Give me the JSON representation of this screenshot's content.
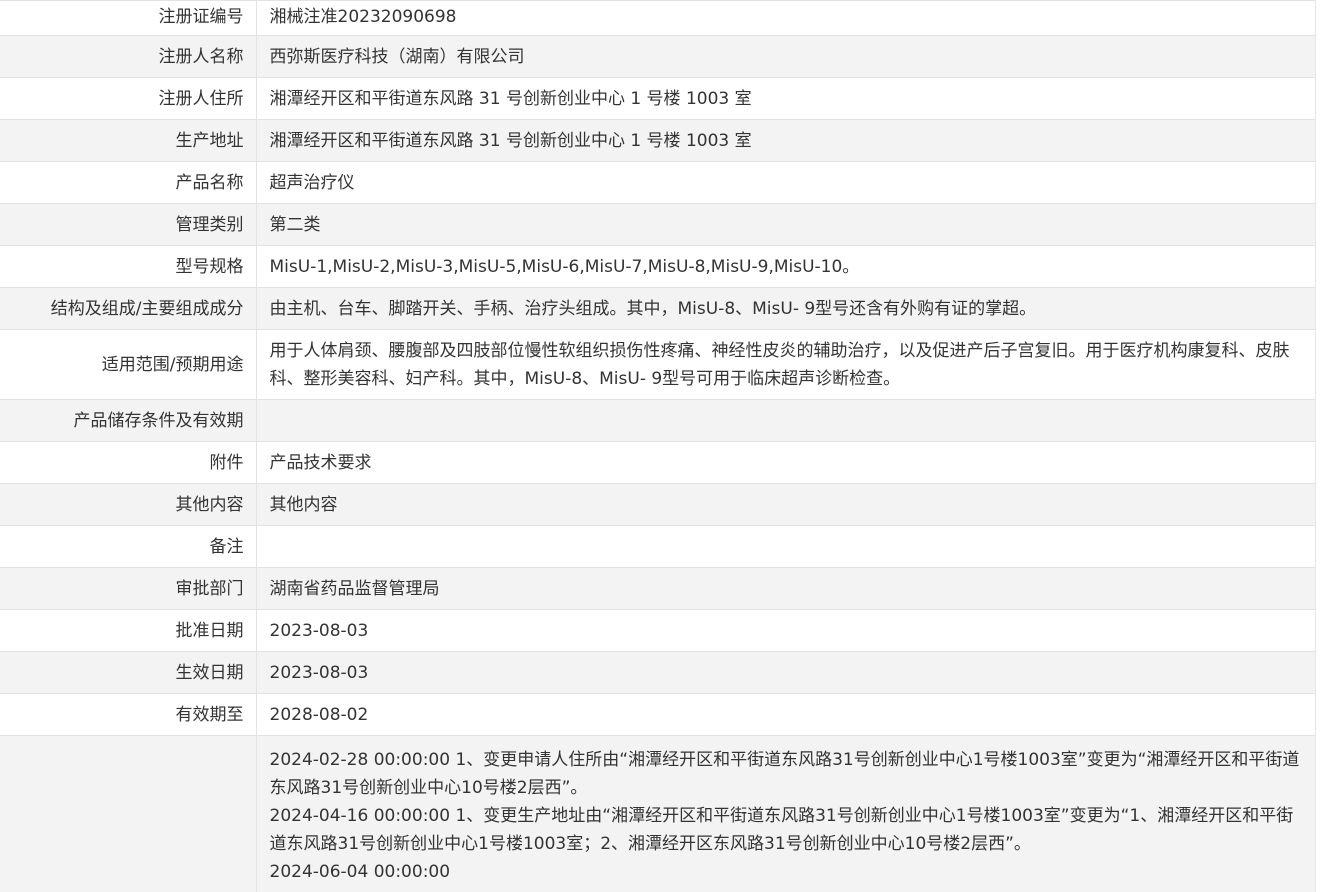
{
  "rows": [
    {
      "label": "注册证编号",
      "value": "湘械注准20232090698"
    },
    {
      "label": "注册人名称",
      "value": "西弥斯医疗科技（湖南）有限公司"
    },
    {
      "label": "注册人住所",
      "value": "湘潭经开区和平街道东风路 31 号创新创业中心 1 号楼 1003 室"
    },
    {
      "label": "生产地址",
      "value": "湘潭经开区和平街道东风路 31 号创新创业中心 1 号楼 1003 室"
    },
    {
      "label": "产品名称",
      "value": "超声治疗仪"
    },
    {
      "label": "管理类别",
      "value": "第二类"
    },
    {
      "label": "型号规格",
      "value": "MisU-1,MisU-2,MisU-3,MisU-5,MisU-6,MisU-7,MisU-8,MisU-9,MisU-10。"
    },
    {
      "label": "结构及组成/主要组成成分",
      "value": "由主机、台车、脚踏开关、手柄、治疗头组成。其中，MisU-8、MisU- 9型号还含有外购有证的掌超。"
    },
    {
      "label": "适用范围/预期用途",
      "value": "用于人体肩颈、腰腹部及四肢部位慢性软组织损伤性疼痛、神经性皮炎的辅助治疗，以及促进产后子宫复旧。用于医疗机构康复科、皮肤科、整形美容科、妇产科。其中，MisU-8、MisU- 9型号可用于临床超声诊断检查。"
    },
    {
      "label": "产品储存条件及有效期",
      "value": ""
    },
    {
      "label": "附件",
      "value": "产品技术要求"
    },
    {
      "label": "其他内容",
      "value": "其他内容"
    },
    {
      "label": "备注",
      "value": ""
    },
    {
      "label": "审批部门",
      "value": "湖南省药品监督管理局"
    },
    {
      "label": "批准日期",
      "value": "2023-08-03"
    },
    {
      "label": "生效日期",
      "value": "2023-08-03"
    },
    {
      "label": "有效期至",
      "value": "2028-08-02"
    }
  ],
  "change_history": {
    "label": "",
    "entries": [
      "2024-02-28 00:00:00 1、变更申请人住所由“湘潭经开区和平街道东风路31号创新创业中心1号楼1003室”变更为“湘潭经开区和平街道东风路31号创新创业中心10号楼2层西”。",
      "2024-04-16 00:00:00 1、变更生产地址由“湘潭经开区和平街道东风路31号创新创业中心1号楼1003室”变更为“1、湘潭经开区和平街道东风路31号创新创业中心1号楼1003室；2、湘潭经开区东风路31号创新创业中心10号楼2层西”。",
      "2024-06-04 00:00:00"
    ]
  }
}
